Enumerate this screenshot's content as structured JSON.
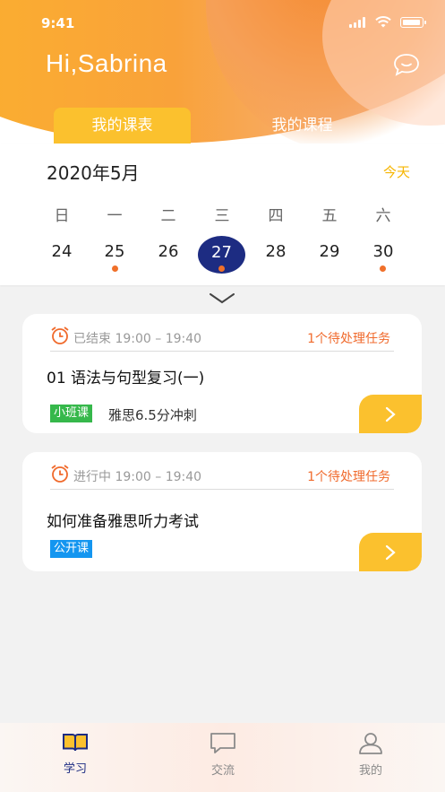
{
  "status_bar": {
    "time": "9:41"
  },
  "header": {
    "greeting": "Hi,Sabrina",
    "message_icon": "chat-bubble-icon"
  },
  "tabs": [
    {
      "label": "我的课表",
      "active": true
    },
    {
      "label": "我的课程",
      "active": false
    }
  ],
  "calendar": {
    "month_label": "2020年5月",
    "today_button": "今天",
    "weekdays": [
      "日",
      "一",
      "二",
      "三",
      "四",
      "五",
      "六"
    ],
    "days": [
      "24",
      "25",
      "26",
      "27",
      "28",
      "29",
      "30"
    ],
    "selected_day": "27",
    "marked_days": [
      "25",
      "27",
      "30"
    ]
  },
  "classes": [
    {
      "status": "已结束 19:00 – 19:40",
      "pending": "1个待处理任务",
      "title": "01 语法与句型复习(一)",
      "badge": "小班课",
      "badge_color": "#36b84b",
      "course": "雅思6.5分冲刺"
    },
    {
      "status": "进行中 19:00 – 19:40",
      "pending": "1个待处理任务",
      "title": "如何准备雅思听力考试",
      "badge": "公开课",
      "badge_color": "#1496f0",
      "course": ""
    }
  ],
  "bottom_nav": [
    {
      "label": "学习",
      "icon": "book-icon",
      "active": true
    },
    {
      "label": "交流",
      "icon": "chat-icon",
      "active": false
    },
    {
      "label": "我的",
      "icon": "user-icon",
      "active": false
    }
  ],
  "colors": {
    "accent": "#fbc12e",
    "selected": "#1d2c82",
    "alert": "#f06a2c"
  }
}
